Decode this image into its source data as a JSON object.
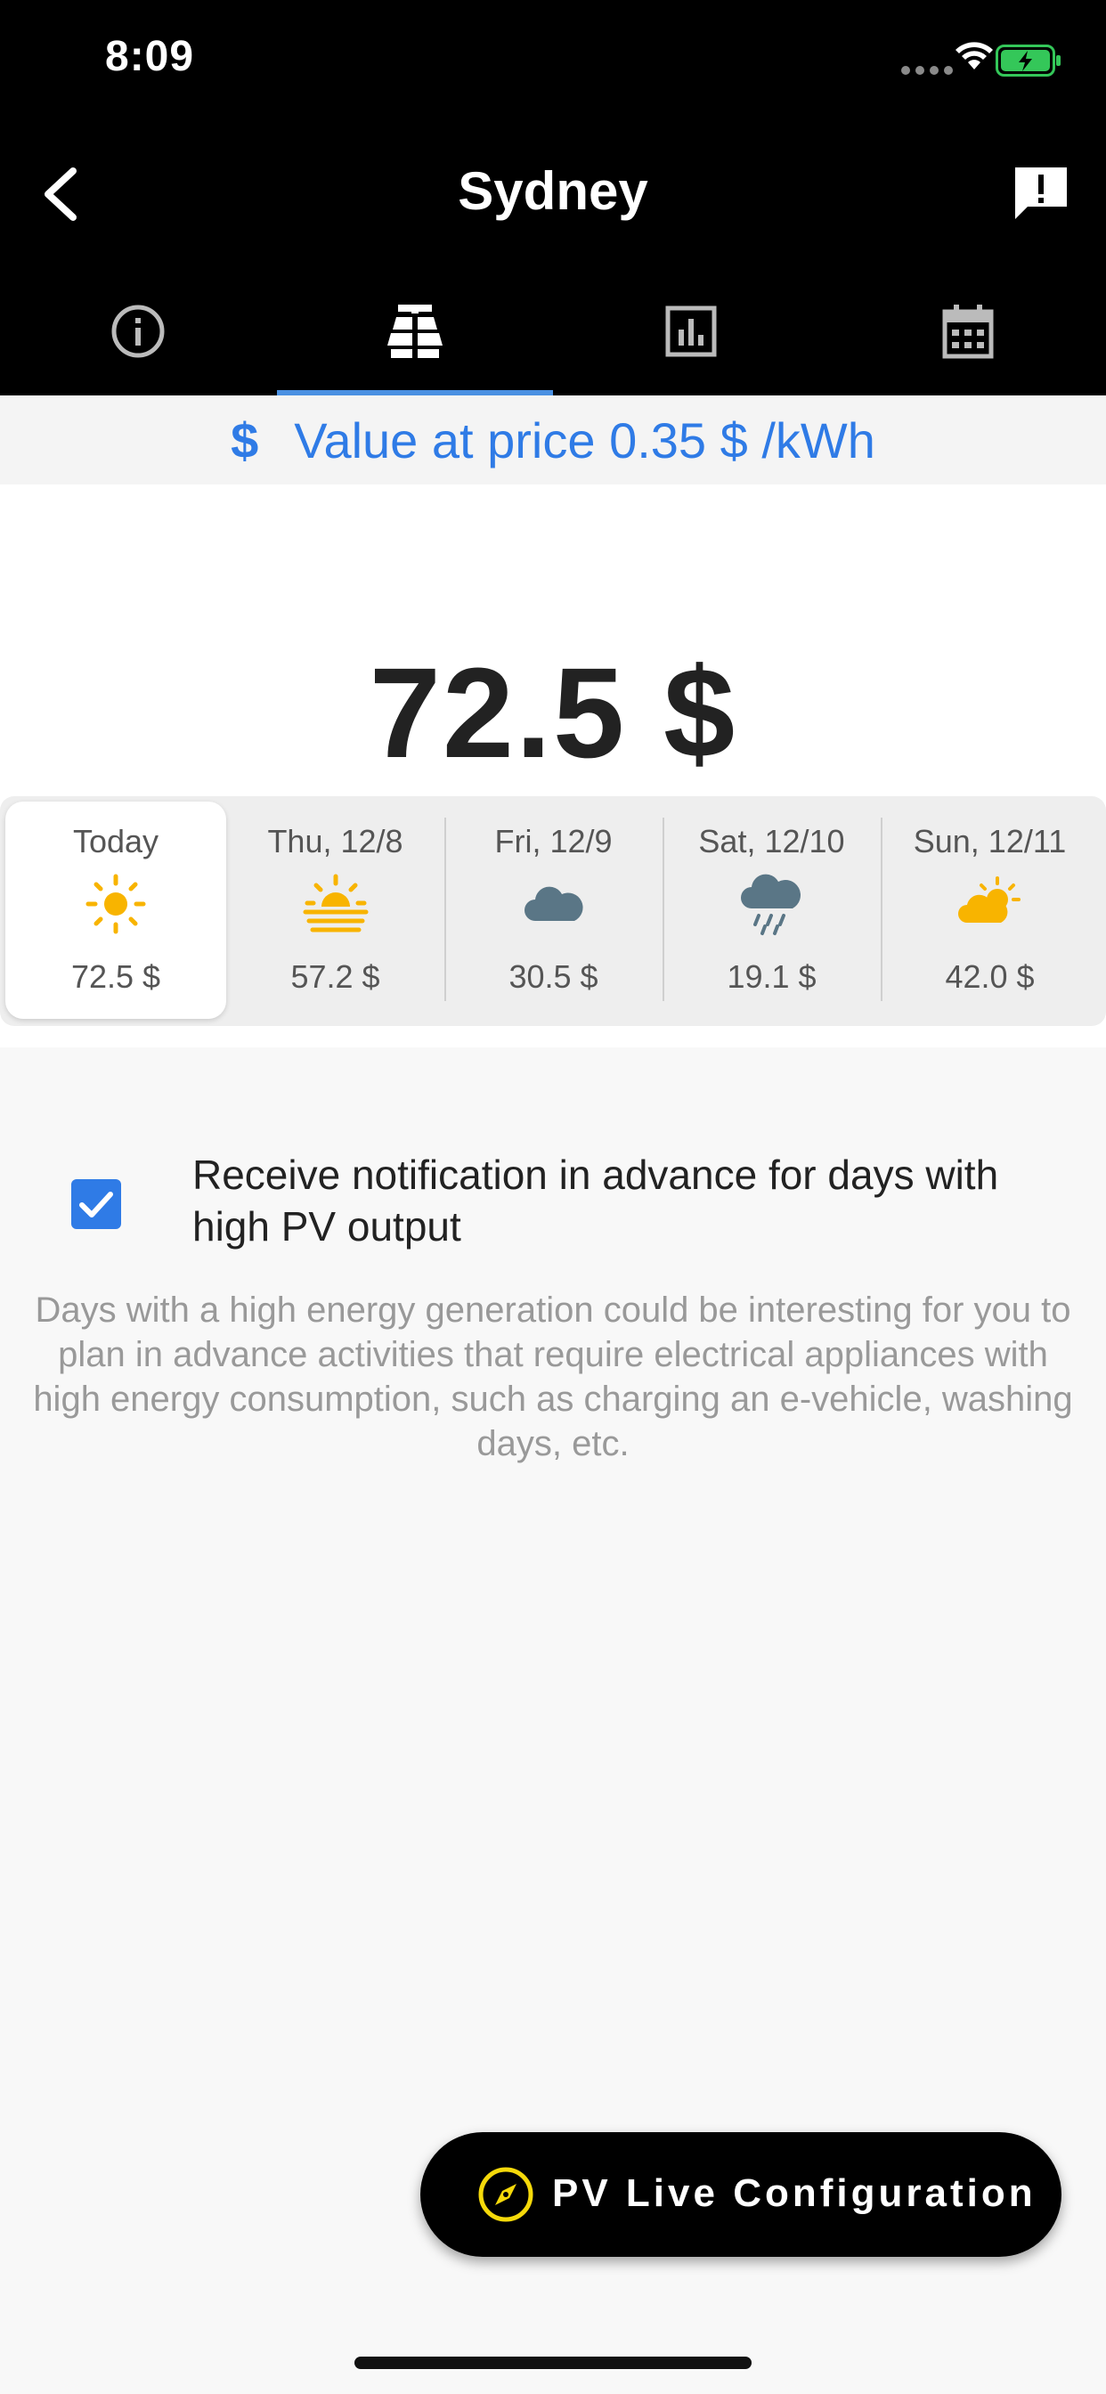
{
  "status_bar": {
    "time": "8:09",
    "signal_icon": "cellular-signal-icon",
    "wifi_icon": "wifi-icon",
    "battery_icon": "battery-charging-icon",
    "battery_color": "#34c759"
  },
  "header": {
    "title": "Sydney",
    "back_icon": "chevron-left-icon",
    "report_icon": "report-icon"
  },
  "tabs": [
    {
      "icon": "info-icon",
      "active": false
    },
    {
      "icon": "solar-panel-icon",
      "active": true
    },
    {
      "icon": "bar-chart-icon",
      "active": false
    },
    {
      "icon": "calendar-icon",
      "active": false
    }
  ],
  "price_banner": {
    "icon": "dollar-icon",
    "icon_text": "$",
    "text": "Value at price 0.35 $ /kWh"
  },
  "main": {
    "value": "72.5 $"
  },
  "days": [
    {
      "label": "Today",
      "icon": "sun-icon",
      "value": "72.5 $",
      "selected": true
    },
    {
      "label": "Thu, 12/8",
      "icon": "sunset-icon",
      "value": "57.2 $",
      "selected": false
    },
    {
      "label": "Fri, 12/9",
      "icon": "cloud-icon",
      "value": "30.5 $",
      "selected": false
    },
    {
      "label": "Sat, 12/10",
      "icon": "rain-icon",
      "value": "19.1 $",
      "selected": false
    },
    {
      "label": "Sun, 12/11",
      "icon": "partly-cloudy-icon",
      "value": "42.0 $",
      "selected": false
    }
  ],
  "notification": {
    "checked": true,
    "label": "Receive notification in advance for days with high PV output",
    "description": "Days with a high energy generation could be interesting for you to plan in advance activities that require electrical appliances with high energy consumption, such as charging an e-vehicle, washing days, etc."
  },
  "fab": {
    "icon": "compass-icon",
    "label": "PV Live Configuration"
  },
  "colors": {
    "accent": "#2f7be6",
    "tab_indicator": "#4a90e2",
    "sun": "#f8b400",
    "cloud": "#5a7686"
  }
}
